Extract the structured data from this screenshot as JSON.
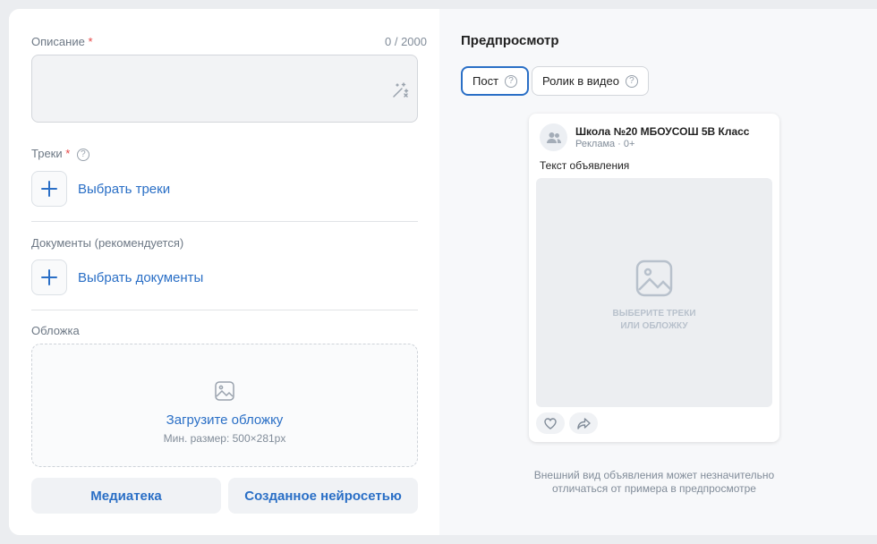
{
  "form": {
    "description_label": "Описание",
    "required_mark": "*",
    "description_counter": "0 / 2000",
    "tracks_label": "Треки",
    "help_glyph": "?",
    "tracks_button": "Выбрать треки",
    "documents_label": "Документы (рекомендуется)",
    "documents_button": "Выбрать документы",
    "cover_label": "Обложка",
    "cover_upload": "Загрузите обложку",
    "cover_hint": "Мин. размер: 500×281px",
    "media_library_button": "Медиатека",
    "ai_generated_button": "Созданное нейросетью"
  },
  "preview": {
    "title": "Предпросмотр",
    "tabs": [
      {
        "label": "Пост",
        "active": true
      },
      {
        "label": "Ролик в видео",
        "active": false
      }
    ],
    "post": {
      "org_name": "Школа №20 МБОУСОШ 5В Класс",
      "ad_meta": "Реклама · 0+",
      "ad_text": "Текст объявления",
      "placeholder_line1": "ВЫБЕРИТЕ ТРЕКИ",
      "placeholder_line2": "ИЛИ ОБЛОЖКУ"
    },
    "note_line1": "Внешний вид объявления может незначительно",
    "note_line2": "отличаться от примера в предпросмотре"
  },
  "icons": [
    "magic-wand-icon",
    "help-icon",
    "plus-icon",
    "image-icon",
    "users-icon",
    "heart-icon",
    "share-icon"
  ],
  "colors": {
    "accent": "#2a6fc6",
    "required": "#e64646",
    "muted": "#818c99",
    "page_bg": "#ebedf0"
  }
}
